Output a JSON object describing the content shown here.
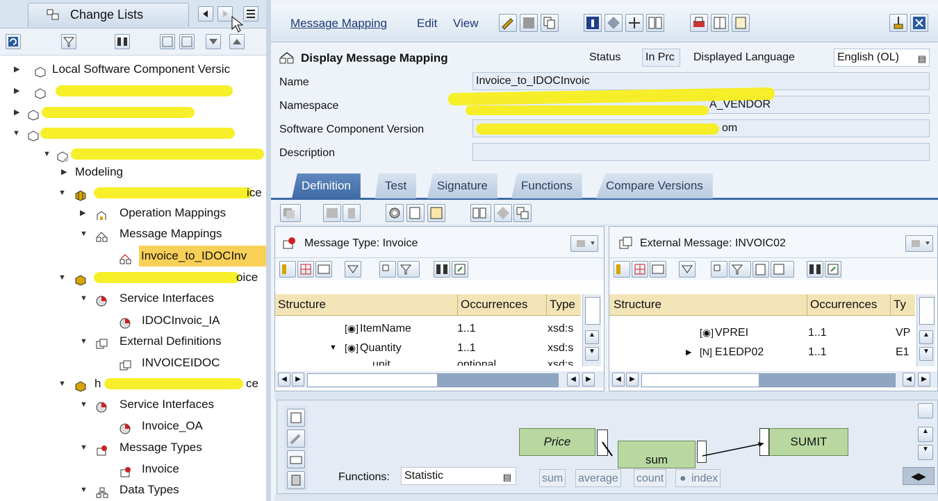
{
  "left_panel": {
    "tab_label": "Change Lists",
    "tree": [
      {
        "label": "Local Software Component Versic",
        "expanded": false,
        "level": 0,
        "redacted": false
      },
      {
        "label": "",
        "expanded": false,
        "level": 0,
        "redacted": true
      },
      {
        "label": "",
        "expanded": false,
        "level": 0,
        "redacted": true
      },
      {
        "label": "",
        "expanded": true,
        "level": 0,
        "redacted": true
      },
      {
        "label": "",
        "expanded": true,
        "level": 1,
        "redacted": true
      },
      {
        "label": "Modeling",
        "expanded": false,
        "level": 2
      },
      {
        "label": "ice",
        "expanded": true,
        "level": 2,
        "redacted": true
      },
      {
        "label": "Operation Mappings",
        "expanded": false,
        "level": 3
      },
      {
        "label": "Message Mappings",
        "expanded": true,
        "level": 3
      },
      {
        "label": "Invoice_to_IDOCInv",
        "level": 4,
        "selected": true
      },
      {
        "label": "oice",
        "expanded": true,
        "level": 2,
        "redacted": true
      },
      {
        "label": "Service Interfaces",
        "expanded": true,
        "level": 3
      },
      {
        "label": "IDOCInvoic_IA",
        "level": 4
      },
      {
        "label": "External Definitions",
        "expanded": true,
        "level": 3
      },
      {
        "label": "INVOICEIDOC",
        "level": 4
      },
      {
        "label": "h",
        "suffix": "ce",
        "expanded": true,
        "level": 2,
        "redacted": true
      },
      {
        "label": "Service Interfaces",
        "expanded": true,
        "level": 3
      },
      {
        "label": "Invoice_OA",
        "level": 4
      },
      {
        "label": "Message Types",
        "expanded": true,
        "level": 3
      },
      {
        "label": "Invoice",
        "level": 4
      },
      {
        "label": "Data Types",
        "expanded": true,
        "level": 3
      }
    ]
  },
  "menubar": {
    "items": [
      "Message Mapping",
      "Edit",
      "View"
    ]
  },
  "header": {
    "title": "Display Message Mapping",
    "status_label": "Status",
    "status_value": "In Prc",
    "lang_label": "Displayed Language",
    "lang_value": "English (OL)"
  },
  "fields": {
    "name_label": "Name",
    "name_value": "Invoice_to_IDOCInvoic",
    "namespace_label": "Namespace",
    "namespace_value": "A_VENDOR",
    "scv_label": "Software Component Version",
    "scv_value": "om",
    "description_label": "Description",
    "description_value": ""
  },
  "tabs": [
    "Definition",
    "Test",
    "Signature",
    "Functions",
    "Compare Versions"
  ],
  "source_pane": {
    "title": "Message Type: Invoice",
    "columns": [
      "Structure",
      "Occurrences",
      "Type"
    ],
    "rows": [
      {
        "name": "ItemName",
        "occ": "1..1",
        "type": "xsd:s"
      },
      {
        "name": "Quantity",
        "occ": "1..1",
        "type": "xsd:s"
      },
      {
        "name": "unit",
        "occ": "optional",
        "type": "xsd:s"
      }
    ]
  },
  "target_pane": {
    "title": "External Message: INVOIC02",
    "columns": [
      "Structure",
      "Occurrences",
      "Ty"
    ],
    "rows": [
      {
        "name": "VPREI",
        "occ": "1..1",
        "type": "VP"
      },
      {
        "name": "E1EDP02",
        "occ": "1..1",
        "type": "E1"
      }
    ]
  },
  "mapping": {
    "source_node": "Price",
    "function_node": "sum",
    "target_node": "SUMIT"
  },
  "functions_bar": {
    "label": "Functions:",
    "category": "Statistic",
    "buttons": [
      "sum",
      "average",
      "count",
      "index"
    ]
  }
}
